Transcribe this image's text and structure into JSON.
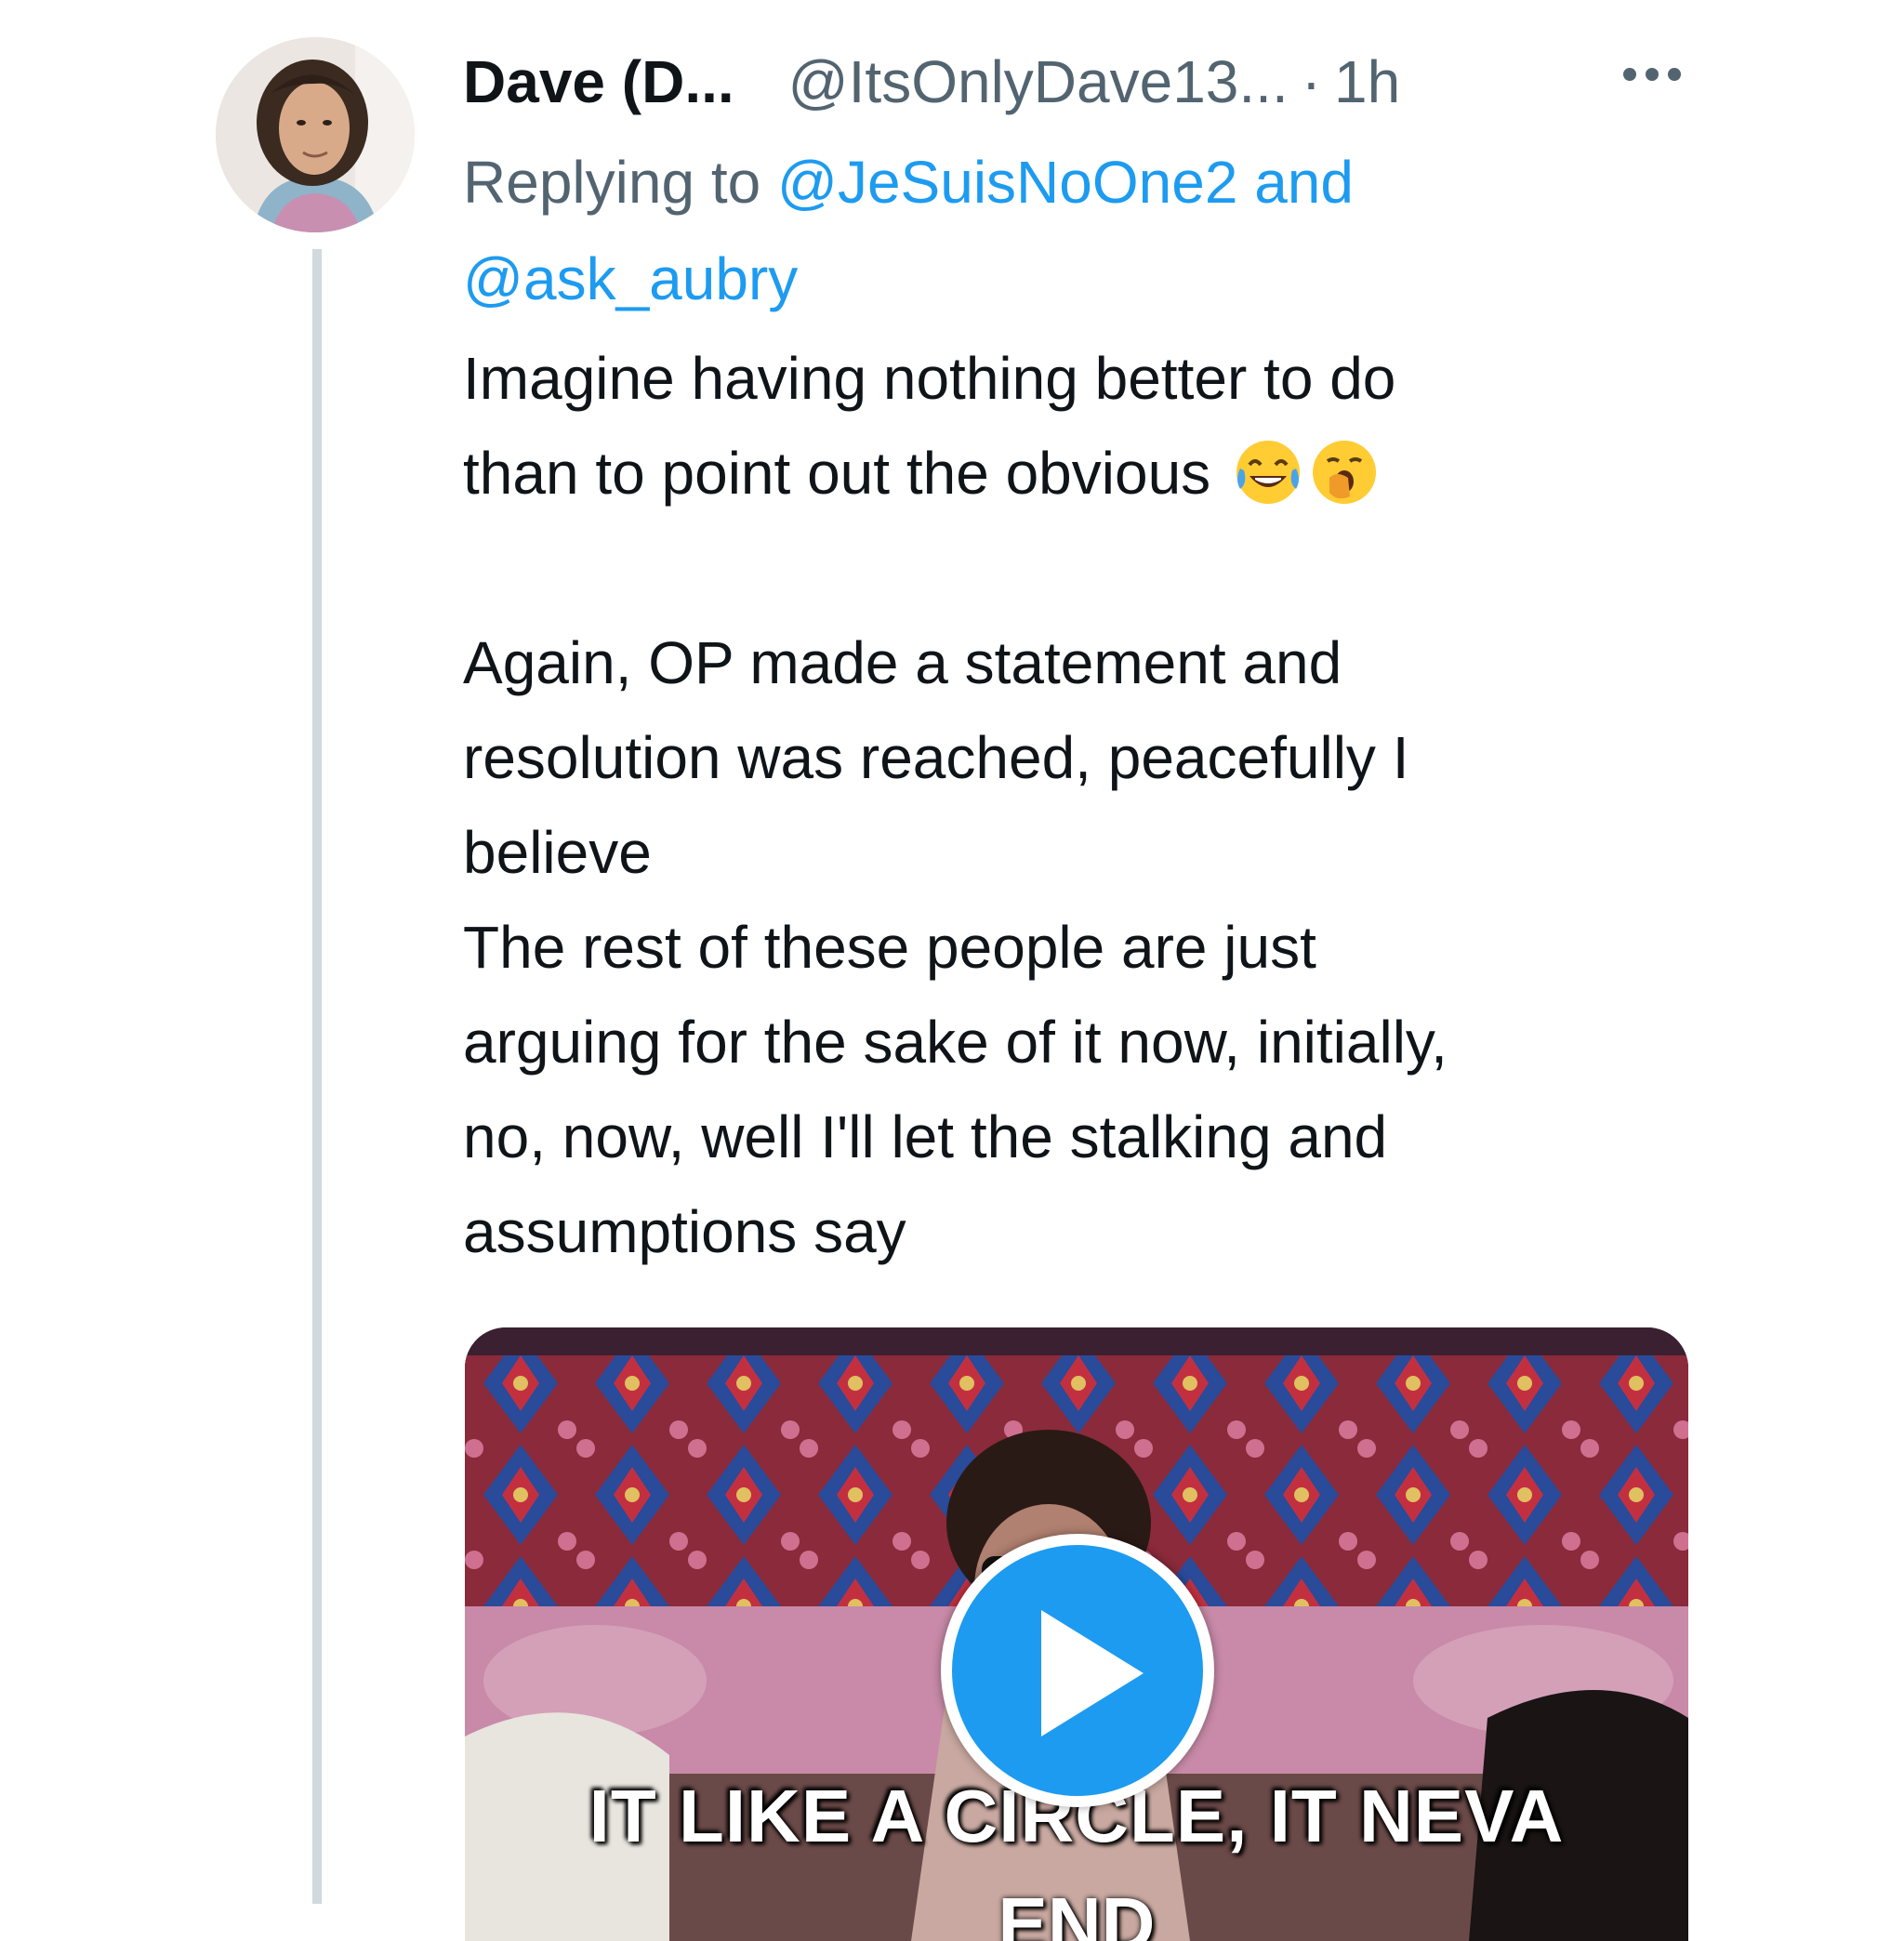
{
  "tweet": {
    "display_name": "Dave (D...",
    "handle": "@ItsOnlyDave13...",
    "separator": "·",
    "time": "1h",
    "reply": {
      "prefix": "Replying to",
      "mention_1": "@JeSuisNoOne2",
      "conjunction": "and",
      "mention_2": "@ask_aubry"
    },
    "body": {
      "line_1": "Imagine having nothing better to do",
      "line_2": "than to point out the obvious",
      "line_2_emojis": [
        "face-with-tears-of-joy-icon",
        "yawning-face-icon"
      ],
      "line_3": "Again, OP made a statement and",
      "line_4": "resolution was reached, peacefully I",
      "line_5": "believe",
      "line_6": "The rest of these people are just",
      "line_7": "arguing for the sake of it now, initially,",
      "line_8": "no, now, well I'll let the stalking and",
      "line_9": "assumptions say"
    },
    "media": {
      "caption_line_1": "IT LIKE A CIRCLE, IT NEVA",
      "caption_line_2": "END",
      "play_icon": "play-icon"
    },
    "more_icon": "more-horizontal-icon"
  },
  "colors": {
    "text_primary": "#0f1419",
    "text_secondary": "#536471",
    "accent": "#1d9bf0",
    "thread_line": "#cfd9de"
  }
}
